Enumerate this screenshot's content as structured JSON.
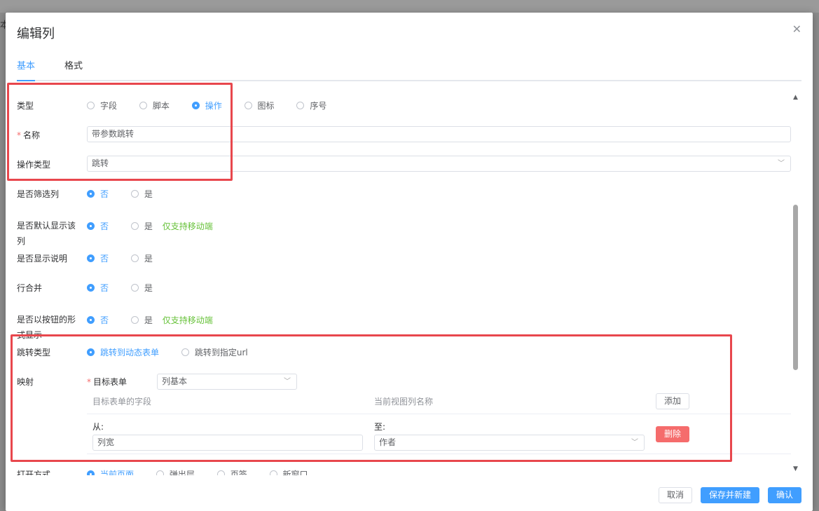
{
  "background": {
    "partial_text": "本"
  },
  "dialog": {
    "title": "编辑列"
  },
  "tabs": [
    {
      "label": "基本",
      "active": true
    },
    {
      "label": "格式",
      "active": false
    }
  ],
  "form": {
    "type": {
      "label": "类型",
      "options": [
        "字段",
        "脚本",
        "操作",
        "图标",
        "序号"
      ],
      "selected": "操作"
    },
    "name": {
      "label": "名称",
      "required_mark": "*",
      "value": "带参数跳转"
    },
    "action_type": {
      "label": "操作类型",
      "value": "跳转"
    },
    "filter_column": {
      "label": "是否筛选列",
      "options": [
        "否",
        "是"
      ],
      "selected": "否"
    },
    "default_show": {
      "label": "是否默认显示该列",
      "options": [
        "否",
        "是"
      ],
      "selected": "否",
      "hint": "仅支持移动端"
    },
    "show_desc": {
      "label": "是否显示说明",
      "options": [
        "否",
        "是"
      ],
      "selected": "否"
    },
    "row_merge": {
      "label": "行合并",
      "options": [
        "否",
        "是"
      ],
      "selected": "否"
    },
    "as_button": {
      "label": "是否以按钮的形式显示",
      "options": [
        "否",
        "是"
      ],
      "selected": "否",
      "hint": "仅支持移动端"
    },
    "jump_type": {
      "label": "跳转类型",
      "options": [
        "跳转到动态表单",
        "跳转到指定url"
      ],
      "selected": "跳转到动态表单"
    },
    "mapping": {
      "label": "映射",
      "target_form_label": "目标表单",
      "required_mark": "*",
      "target_form_value": "列基本",
      "col_target_field": "目标表单的字段",
      "col_view_column": "当前视图列名称",
      "add_label": "添加",
      "from_label": "从:",
      "to_label": "至:",
      "from_value": "列宽",
      "to_value": "作者",
      "delete_label": "删除"
    },
    "open_mode": {
      "label": "打开方式",
      "options": [
        "当前页面",
        "弹出层",
        "页签",
        "新窗口"
      ],
      "selected": "当前页面"
    }
  },
  "footer": {
    "cancel": "取消",
    "save_new": "保存并新建",
    "confirm": "确认"
  },
  "icons": {
    "close": "close-icon",
    "chevron": "chevron-down-icon"
  },
  "colors": {
    "accent": "#409eff",
    "danger": "#f56c6c",
    "hint": "#67c23a",
    "annotation": "#e8474d"
  }
}
